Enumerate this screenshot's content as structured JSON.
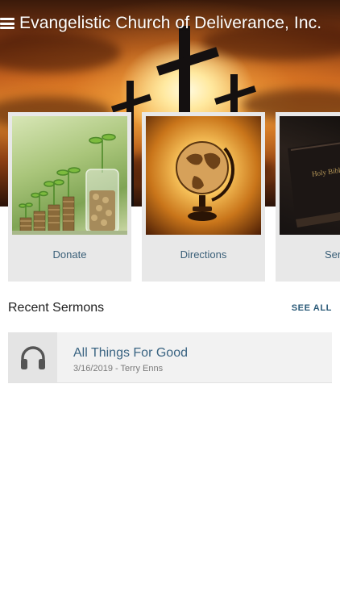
{
  "header": {
    "app_title": "Evangelistic Church of Deliverance, Inc.",
    "menu_icon": "hamburger-menu-icon"
  },
  "tiles": [
    {
      "label": "Donate",
      "image": "coins-and-plants"
    },
    {
      "label": "Directions",
      "image": "globe"
    },
    {
      "label": "Serm",
      "image": "bible"
    }
  ],
  "recent_sermons": {
    "title": "Recent Sermons",
    "see_all_label": "SEE ALL",
    "items": [
      {
        "title": "All Things For Good",
        "meta": "3/16/2019 - Terry Enns",
        "icon": "headphones-icon"
      }
    ]
  },
  "colors": {
    "accent": "#3a6482",
    "tile_bg": "#e8e8e8",
    "row_bg": "#f2f2f2"
  }
}
